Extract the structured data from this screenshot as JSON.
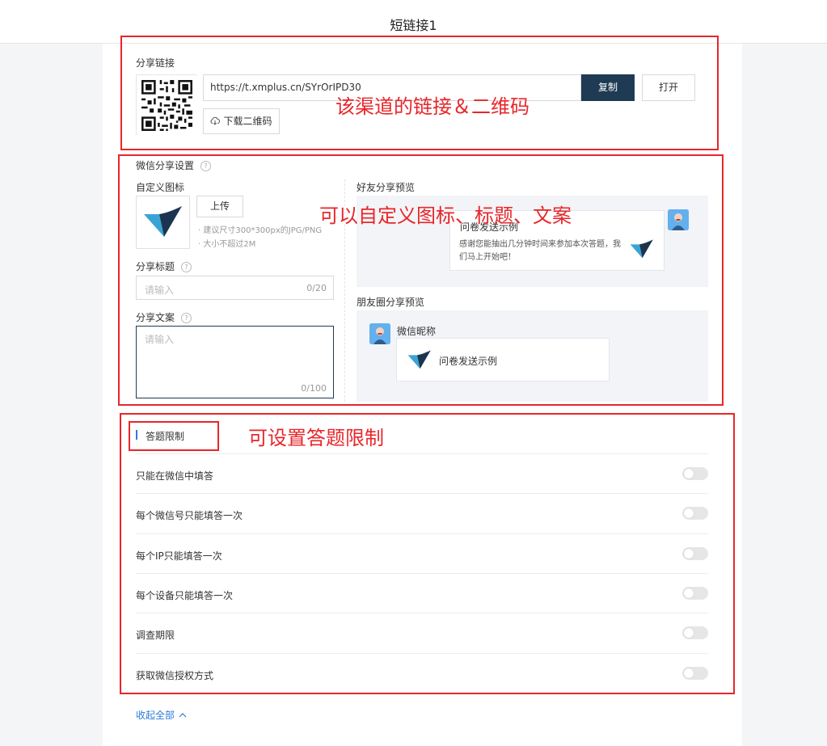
{
  "page": {
    "title": "短链接1"
  },
  "share_link": {
    "section_label": "分享链接",
    "url": "https://t.xmplus.cn/SYrOrIPD30",
    "copy_label": "复制",
    "open_label": "打开",
    "download_qr_label": "下载二维码"
  },
  "wechat_share": {
    "section_label": "微信分享设置",
    "custom_icon_label": "自定义图标",
    "upload_label": "上传",
    "hint_size": "· 建议尺寸300*300px的JPG/PNG",
    "hint_limit": "· 大小不超过2M",
    "share_title_label": "分享标题",
    "share_title_placeholder": "请输入",
    "share_title_count": "0/20",
    "share_text_label": "分享文案",
    "share_text_placeholder": "请输入",
    "share_text_count": "0/100",
    "friend_preview_label": "好友分享预览",
    "friend_card_title": "问卷发送示例",
    "friend_card_desc": "感谢您能抽出几分钟时间来参加本次答题，我们马上开始吧！",
    "moments_preview_label": "朋友圈分享预览",
    "moments_nickname": "微信昵称",
    "moments_card_title": "问卷发送示例"
  },
  "answer_limits": {
    "section_label": "答题限制",
    "rows": [
      {
        "label": "只能在微信中填答",
        "enabled": false
      },
      {
        "label": "每个微信号只能填答一次",
        "enabled": false
      },
      {
        "label": "每个IP只能填答一次",
        "enabled": false
      },
      {
        "label": "每个设备只能填答一次",
        "enabled": false
      },
      {
        "label": "调查期限",
        "enabled": false
      },
      {
        "label": "获取微信授权方式",
        "enabled": false
      }
    ],
    "collapse_label": "收起全部"
  },
  "annotations": {
    "link_qr": "该渠道的链接＆二维码",
    "customize": "可以自定义图标、标题、文案",
    "limits": "可设置答题限制"
  },
  "colors": {
    "annotation": "#e8262a",
    "primary": "#1f3b53",
    "link": "#2d7bd8",
    "section_bar": "#2d7bd8"
  }
}
